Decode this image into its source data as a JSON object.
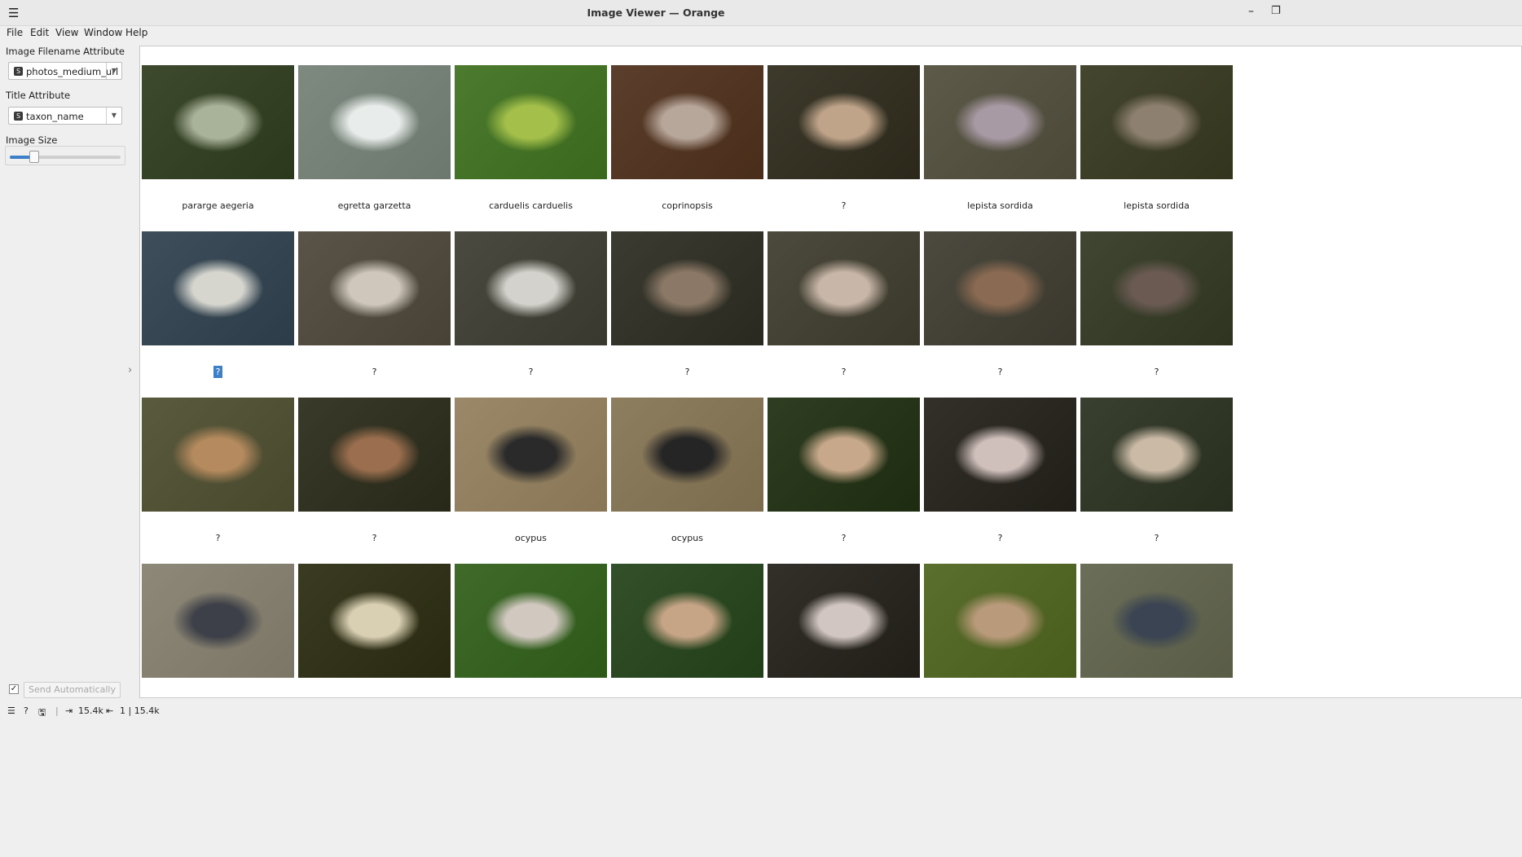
{
  "window": {
    "title": "Image Viewer — Orange",
    "menu_icon": "hamburger-icon",
    "minimize": "–",
    "maximize": "❐"
  },
  "menu": [
    "File",
    "Edit",
    "View",
    "Window",
    "Help"
  ],
  "controls": {
    "filename_label": "Image Filename Attribute",
    "filename_value": "photos_medium_url",
    "filename_badge": "S",
    "title_label": "Title Attribute",
    "title_value": "taxon_name",
    "title_badge": "S",
    "size_label": "Image Size",
    "size_level": 0.22,
    "auto_check": "✓",
    "send_label": "Send Automatically"
  },
  "status": {
    "input_count": "15.4k",
    "output_count": "1 | 15.4k"
  },
  "grid": [
    [
      {
        "caption": "pararge aegeria",
        "bg": "#3e4a2e",
        "fg": "#a9b39a"
      },
      {
        "caption": "egretta garzetta",
        "bg": "#7e8a80",
        "fg": "#e8ecea"
      },
      {
        "caption": "carduelis carduelis",
        "bg": "#4c7a2e",
        "fg": "#a4c04a"
      },
      {
        "caption": "coprinopsis",
        "bg": "#5b3f2c",
        "fg": "#b7a69a"
      },
      {
        "caption": "?",
        "bg": "#3d3a2c",
        "fg": "#c0a48a"
      },
      {
        "caption": "lepista sordida",
        "bg": "#5d5a4a",
        "fg": "#a89aa4"
      },
      {
        "caption": "lepista sordida",
        "bg": "#45462f",
        "fg": "#8e8070"
      }
    ],
    [
      {
        "caption": "?",
        "bg": "#3e4e5a",
        "fg": "#d6d6cf",
        "selected": true
      },
      {
        "caption": "?",
        "bg": "#5a5448",
        "fg": "#cfc7bc"
      },
      {
        "caption": "?",
        "bg": "#4b4a40",
        "fg": "#d3d2cc"
      },
      {
        "caption": "?",
        "bg": "#3b3b31",
        "fg": "#8b7866"
      },
      {
        "caption": "?",
        "bg": "#4c4a3c",
        "fg": "#c8b6a8"
      },
      {
        "caption": "?",
        "bg": "#4c4a3f",
        "fg": "#8a6a52"
      },
      {
        "caption": "?",
        "bg": "#404632",
        "fg": "#6a5a52"
      }
    ],
    [
      {
        "caption": "?",
        "bg": "#5a5a3e",
        "fg": "#b58a5e"
      },
      {
        "caption": "?",
        "bg": "#3a3a2a",
        "fg": "#9a6e4e"
      },
      {
        "caption": "ocypus",
        "bg": "#9a8868",
        "fg": "#2a2a2a"
      },
      {
        "caption": "ocypus",
        "bg": "#8e7e60",
        "fg": "#252525"
      },
      {
        "caption": "?",
        "bg": "#2f3d22",
        "fg": "#c7a88a"
      },
      {
        "caption": "?",
        "bg": "#33302a",
        "fg": "#d0c0bc"
      },
      {
        "caption": "?",
        "bg": "#3a4030",
        "fg": "#cabaa6"
      }
    ],
    [
      {
        "caption": "",
        "bg": "#8e8878",
        "fg": "#3d4048"
      },
      {
        "caption": "",
        "bg": "#3a3b22",
        "fg": "#d9cfb3"
      },
      {
        "caption": "",
        "bg": "#3f6a2a",
        "fg": "#d1c8c0"
      },
      {
        "caption": "",
        "bg": "#33502a",
        "fg": "#c6a486"
      },
      {
        "caption": "",
        "bg": "#33302a",
        "fg": "#d2c6c2"
      },
      {
        "caption": "",
        "bg": "#5a6e2e",
        "fg": "#b99a7a"
      },
      {
        "caption": "",
        "bg": "#6b6e58",
        "fg": "#3a4452"
      }
    ]
  ]
}
